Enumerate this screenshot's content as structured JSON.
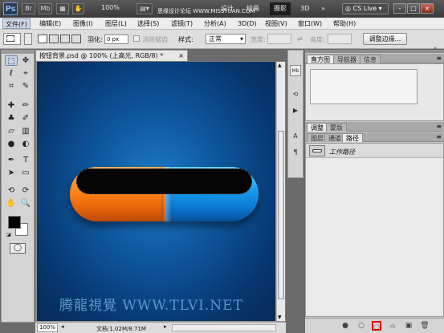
{
  "titlebar": {
    "app_logo": "Ps",
    "br_label": "Br",
    "mb_label": "Mb",
    "zoom": "100%",
    "workspaces": [
      "设计",
      "绘画",
      "摄影",
      "3D"
    ],
    "more": "»",
    "cslive_label": "CS Live",
    "window_buttons": [
      "-",
      "□",
      "×"
    ]
  },
  "watermark_top": "思缘设计论坛 WWW.MISSYUAN.COM",
  "menu": [
    "文件(F)",
    "编辑(E)",
    "图像(I)",
    "图层(L)",
    "选择(S)",
    "滤镜(T)",
    "分析(A)",
    "3D(D)",
    "视图(V)",
    "窗口(W)",
    "帮助(H)"
  ],
  "options": {
    "feather_label": "羽化:",
    "feather_value": "0 px",
    "antialias_label": "消除锯齿",
    "style_label": "样式:",
    "style_value": "正常",
    "width_label": "宽度:",
    "height_label": "高度:",
    "refine_label": "调整边缘..."
  },
  "document": {
    "tab_title": "按钮背景.psd @ 100% (上高光, RGB/8) *",
    "close": "×",
    "watermark": "腾龍視覺 WWW.TLVI.NET",
    "zoom": "100%",
    "doc_info": "文档:1.02M/8.71M"
  },
  "panels": {
    "top_tabs": [
      "直方图",
      "导航器",
      "信息"
    ],
    "mid_tabs": [
      "调整",
      "蒙版"
    ],
    "bottom_tabs": [
      "图层",
      "通道",
      "路径"
    ],
    "path_name": "工作路径"
  },
  "colors": {
    "canvas_bg": "#0f5aa2",
    "capsule_orange": "#ff8a1a",
    "capsule_blue": "#1aa0ef",
    "highlight_button": "#e00000"
  }
}
